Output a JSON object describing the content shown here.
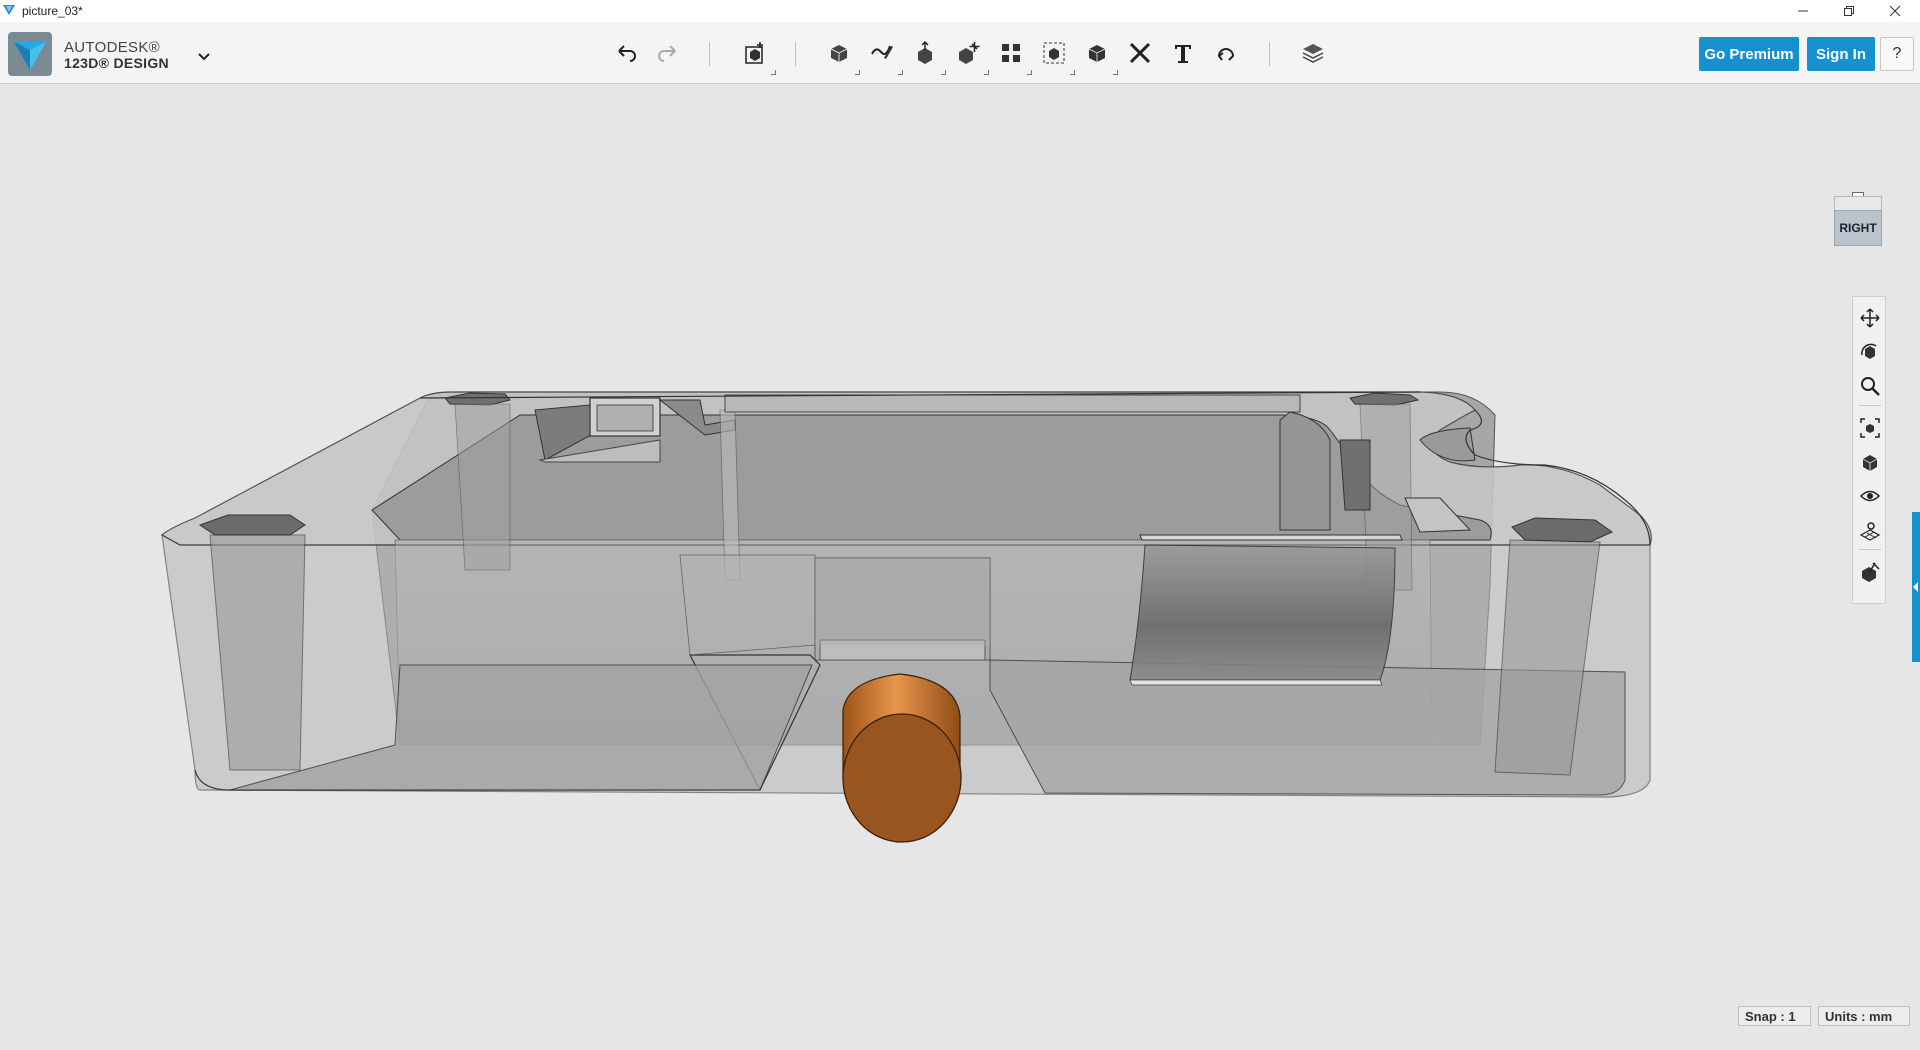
{
  "window": {
    "title": "picture_03*",
    "controls": [
      "minimize",
      "restore",
      "close"
    ]
  },
  "brand": {
    "line1": "AUTODESK®",
    "line2": "123D® DESIGN",
    "logo_color": "#2a9fd8"
  },
  "toolbar": {
    "tools": [
      {
        "name": "undo-icon"
      },
      {
        "name": "redo-icon"
      },
      {
        "name": "transform-icon"
      },
      {
        "name": "primitives-icon"
      },
      {
        "name": "sketch-icon"
      },
      {
        "name": "construct-icon"
      },
      {
        "name": "modify-icon"
      },
      {
        "name": "pattern-icon"
      },
      {
        "name": "grouping-icon"
      },
      {
        "name": "combine-icon"
      },
      {
        "name": "measure-icon"
      },
      {
        "name": "text-icon"
      },
      {
        "name": "snap-icon"
      },
      {
        "name": "material-icon"
      }
    ],
    "go_premium": "Go Premium",
    "sign_in": "Sign In",
    "help": "?"
  },
  "viewcube": {
    "face_label": "RIGHT"
  },
  "navbar": {
    "items": [
      "pan-icon",
      "orbit-icon",
      "zoom-icon",
      "fit-icon",
      "view-mode-icon",
      "visibility-icon",
      "grid-icon",
      "material-display-icon"
    ]
  },
  "status": {
    "snap": "Snap : 1",
    "units": "Units : mm"
  },
  "colors": {
    "accent": "#1591cf",
    "cylinder": "#b8681e",
    "body": "#a8a8a8",
    "background": "#e6e6e6"
  }
}
